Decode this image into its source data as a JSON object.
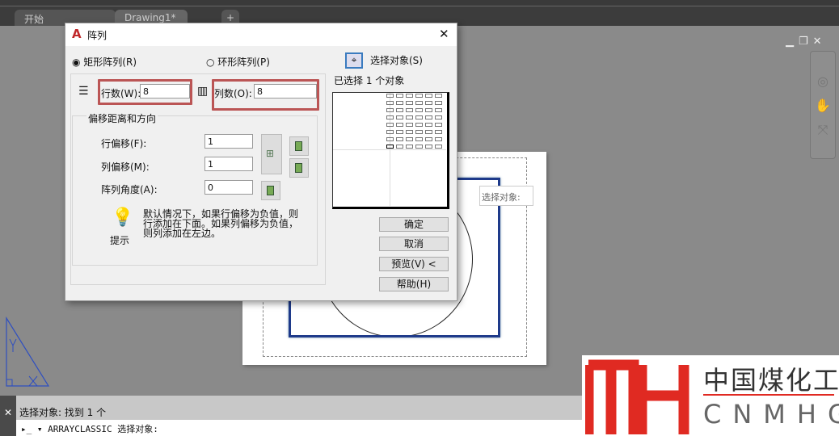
{
  "tabs": [
    {
      "label": "开始"
    },
    {
      "label": "Drawing1*",
      "close": "×"
    },
    {
      "label": "+"
    }
  ],
  "dialog": {
    "title": "阵列",
    "close": "✕",
    "radio_rect": "矩形阵列(R)",
    "radio_polar": "环形阵列(P)",
    "rect_selected": true,
    "select_objects": "选择对象(S)",
    "selected_count": "已选择 1 个对象",
    "rows_label": "行数(W):",
    "rows_value": "8",
    "cols_label": "列数(O):",
    "cols_value": "8",
    "group_title": "偏移距离和方向",
    "row_offset_label": "行偏移(F):",
    "row_offset_value": "1",
    "col_offset_label": "列偏移(M):",
    "col_offset_value": "1",
    "angle_label": "阵列角度(A):",
    "angle_value": "0",
    "tip_label": "提示",
    "tip_text": "默认情况下，如果行偏移为负值，则行添加在下面。如果列偏移为负值，则列添加在左边。",
    "buttons": {
      "ok": "确定",
      "cancel": "取消",
      "preview": "预览(V) <",
      "help": "帮助(H)"
    }
  },
  "tooltip": "选择对象:",
  "command": {
    "history": "选择对象: 找到 1 个",
    "current": "ARRAYCLASSIC 选择对象:"
  },
  "logo": {
    "mark": "MH",
    "cn": "中国煤化工",
    "en": "CNMHG"
  },
  "colors": {
    "accent": "#1e3a8a",
    "highlight": "#b55555",
    "logo_red": "#e02a22"
  }
}
